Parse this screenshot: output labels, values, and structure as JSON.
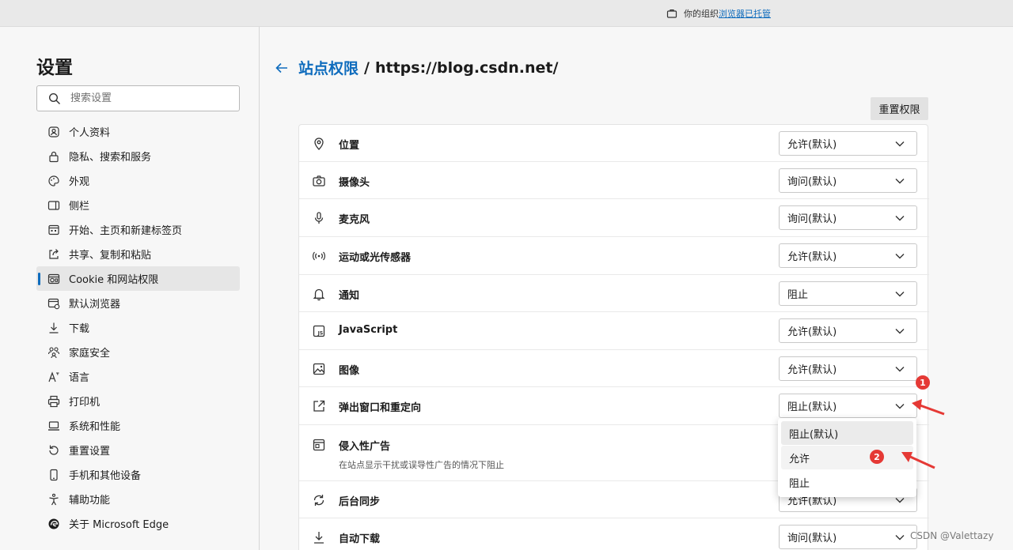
{
  "topbar": {
    "managed_prefix": "你的组织",
    "managed_link": "浏览器已托管"
  },
  "sidebar": {
    "title": "设置",
    "search_placeholder": "搜索设置",
    "items": [
      {
        "label": "个人资料",
        "icon": "profile-icon"
      },
      {
        "label": "隐私、搜索和服务",
        "icon": "lock-icon"
      },
      {
        "label": "外观",
        "icon": "palette-icon"
      },
      {
        "label": "侧栏",
        "icon": "sidebar-icon"
      },
      {
        "label": "开始、主页和新建标签页",
        "icon": "home-tabs-icon"
      },
      {
        "label": "共享、复制和粘贴",
        "icon": "share-icon"
      },
      {
        "label": "Cookie 和网站权限",
        "icon": "cookie-site-icon",
        "active": true
      },
      {
        "label": "默认浏览器",
        "icon": "default-browser-icon"
      },
      {
        "label": "下载",
        "icon": "download-icon"
      },
      {
        "label": "家庭安全",
        "icon": "family-icon"
      },
      {
        "label": "语言",
        "icon": "language-icon"
      },
      {
        "label": "打印机",
        "icon": "printer-icon"
      },
      {
        "label": "系统和性能",
        "icon": "laptop-icon"
      },
      {
        "label": "重置设置",
        "icon": "reset-icon"
      },
      {
        "label": "手机和其他设备",
        "icon": "phone-icon"
      },
      {
        "label": "辅助功能",
        "icon": "accessibility-icon"
      },
      {
        "label": "关于 Microsoft Edge",
        "icon": "edge-icon"
      }
    ]
  },
  "header": {
    "crumb": "站点权限",
    "separator": "/",
    "site": "https://blog.csdn.net/",
    "reset_label": "重置权限"
  },
  "permissions": [
    {
      "label": "位置",
      "value": "允许(默认)",
      "icon": "location-icon"
    },
    {
      "label": "摄像头",
      "value": "询问(默认)",
      "icon": "camera-icon"
    },
    {
      "label": "麦克风",
      "value": "询问(默认)",
      "icon": "microphone-icon"
    },
    {
      "label": "运动或光传感器",
      "value": "允许(默认)",
      "icon": "sensor-icon"
    },
    {
      "label": "通知",
      "value": "阻止",
      "icon": "bell-icon"
    },
    {
      "label": "JavaScript",
      "value": "允许(默认)",
      "icon": "javascript-icon"
    },
    {
      "label": "图像",
      "value": "允许(默认)",
      "icon": "image-icon"
    },
    {
      "label": "弹出窗口和重定向",
      "value": "阻止(默认)",
      "icon": "popup-icon"
    },
    {
      "label": "侵入性广告",
      "sub": "在站点显示干扰或误导性广告的情况下阻止",
      "value": "",
      "icon": "ads-icon"
    },
    {
      "label": "后台同步",
      "value": "允许(默认)",
      "icon": "sync-icon"
    },
    {
      "label": "自动下载",
      "value": "询问(默认)",
      "icon": "download-icon"
    }
  ],
  "dropdown": {
    "options": [
      "阻止(默认)",
      "允许",
      "阻止"
    ],
    "selected_index": 0
  },
  "annotations": {
    "badge1": "1",
    "badge2": "2",
    "color": "#e53935"
  },
  "watermark": "CSDN @Valettazy",
  "colors": {
    "accent": "#0f6cbd",
    "annotation": "#e53935"
  }
}
